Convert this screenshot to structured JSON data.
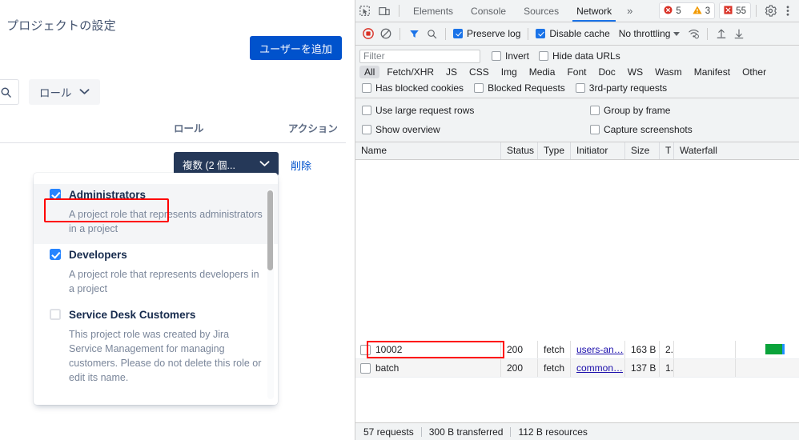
{
  "jira": {
    "page_title": "プロジェクトの設定",
    "add_user_button": "ユーザーを追加",
    "search_icon": "search-icon",
    "role_filter": {
      "label": "ロール",
      "chevron": "chevron-down-icon"
    },
    "table": {
      "columns": [
        "ロール",
        "アクション"
      ],
      "row": {
        "role_select_label": "複数 (2 個...",
        "role_select_chevron": "chevron-down-icon",
        "delete_link": "削除"
      }
    },
    "role_dropdown": {
      "options": [
        {
          "name": "Administrators",
          "description": "A project role that represents administrators in a project",
          "checked": true,
          "highlighted": true
        },
        {
          "name": "Developers",
          "description": "A project role that represents developers in a project",
          "checked": true,
          "highlighted": false
        },
        {
          "name": "Service Desk Customers",
          "description": "This project role was created by Jira Service Management for managing customers. Please do not delete this role or edit its name.",
          "checked": false,
          "highlighted": false
        }
      ]
    },
    "colors": {
      "primary": "#0052cc",
      "dark_button": "#253858",
      "highlight_box": "#ff0000"
    }
  },
  "devtools": {
    "tabbar": {
      "inspect_icon": "inspect-element-icon",
      "device_icon": "device-toolbar-icon",
      "tabs": [
        "Elements",
        "Console",
        "Sources",
        "Network"
      ],
      "selected_tab": "Network",
      "more_tabs": "»",
      "errors": "5",
      "warnings": "3",
      "issues": "55",
      "error_icon": "error-circle-icon",
      "warning_icon": "warning-triangle-icon",
      "issue_icon": "issues-square-icon",
      "settings_icon": "gear-icon",
      "menu_icon": "kebab-menu-icon"
    },
    "toolbar": {
      "record_icon": "record-stop-icon",
      "clear_icon": "clear-icon",
      "filter_icon": "funnel-filter-icon",
      "search_icon": "search-icon",
      "preserve_log": {
        "label": "Preserve log",
        "checked": true
      },
      "disable_cache": {
        "label": "Disable cache",
        "checked": true
      },
      "throttling": "No throttling",
      "throttle_caret": "chevron-down-icon",
      "wifi_icon": "network-conditions-icon",
      "import_icon": "import-har-icon",
      "export_icon": "export-har-icon"
    },
    "filterbar": {
      "filter_placeholder": "Filter",
      "invert": {
        "label": "Invert",
        "checked": false
      },
      "hide_data_urls": {
        "label": "Hide data URLs",
        "checked": false
      },
      "types": [
        "All",
        "Fetch/XHR",
        "JS",
        "CSS",
        "Img",
        "Media",
        "Font",
        "Doc",
        "WS",
        "Wasm",
        "Manifest",
        "Other"
      ],
      "selected_type": "All",
      "has_blocked_cookies": {
        "label": "Has blocked cookies",
        "checked": false
      },
      "blocked_requests": {
        "label": "Blocked Requests",
        "checked": false
      },
      "third_party": {
        "label": "3rd-party requests",
        "checked": false
      }
    },
    "prefbar": {
      "use_large_rows": {
        "label": "Use large request rows",
        "checked": false
      },
      "group_by_frame": {
        "label": "Group by frame",
        "checked": false
      },
      "show_overview": {
        "label": "Show overview",
        "checked": false
      },
      "capture_screenshots": {
        "label": "Capture screenshots",
        "checked": false
      }
    },
    "network_table": {
      "columns": [
        "Name",
        "Status",
        "Type",
        "Initiator",
        "Size",
        "T",
        "Waterfall"
      ],
      "rows": [
        {
          "name": "10002",
          "status": "200",
          "type": "fetch",
          "initiator": "users-an…",
          "size": "163 B",
          "time": "2.",
          "highlighted": true
        },
        {
          "name": "batch",
          "status": "200",
          "type": "fetch",
          "initiator": "common…",
          "size": "137 B",
          "time": "1.",
          "highlighted": false
        }
      ]
    },
    "summary": {
      "requests": "57 requests",
      "transferred": "300 B transferred",
      "resources": "112 B resources"
    }
  }
}
